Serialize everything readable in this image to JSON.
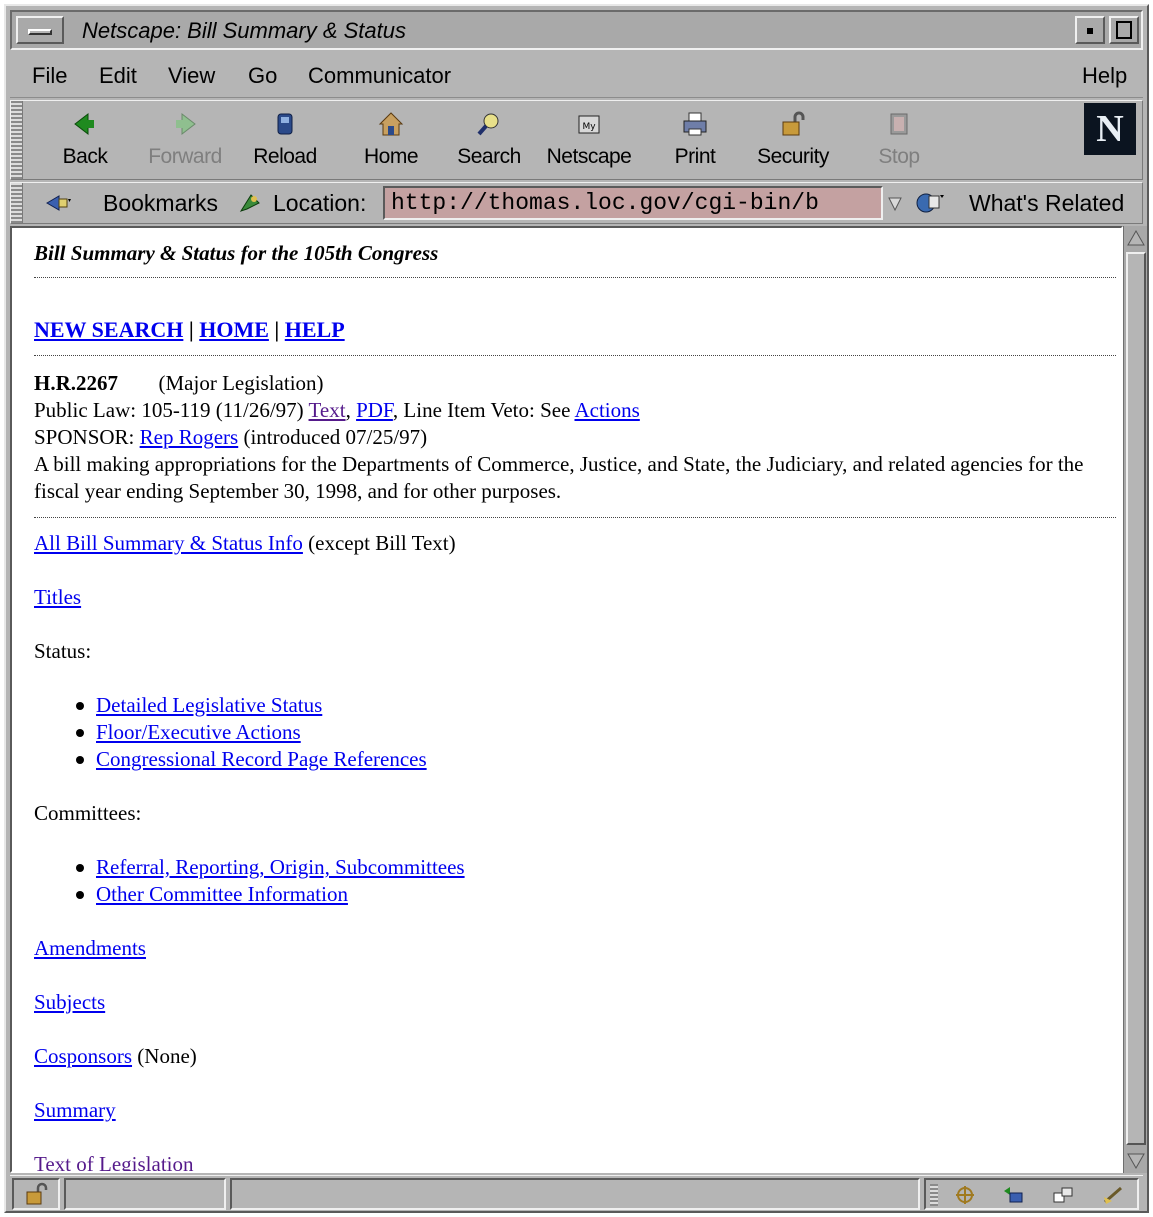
{
  "window": {
    "title": "Netscape: Bill Summary & Status"
  },
  "menu": {
    "file": "File",
    "edit": "Edit",
    "view": "View",
    "go": "Go",
    "communicator": "Communicator",
    "help": "Help"
  },
  "toolbar": {
    "back": "Back",
    "forward": "Forward",
    "reload": "Reload",
    "home": "Home",
    "search": "Search",
    "netscape": "Netscape",
    "print": "Print",
    "security": "Security",
    "stop": "Stop",
    "logo": "N"
  },
  "location": {
    "bookmarks": "Bookmarks",
    "label": "Location:",
    "url": "http://thomas.loc.gov/cgi-bin/b",
    "whats_related": "What's Related"
  },
  "page": {
    "heading": "Bill Summary & Status for the 105th Congress",
    "nav": {
      "new_search": "NEW SEARCH",
      "sep1": " | ",
      "home": "HOME",
      "sep2": " | ",
      "help": "HELP"
    },
    "bill": {
      "number": "H.R.2267",
      "type": "(Major Legislation)",
      "public_law_prefix": "Public Law: 105-119 (11/26/97) ",
      "text_link": "Text",
      "comma": ", ",
      "pdf_link": "PDF",
      "veto_text": ", Line Item Veto: See ",
      "actions_link": "Actions",
      "sponsor_label": "SPONSOR: ",
      "sponsor_link": "Rep Rogers",
      "introduced": " (introduced 07/25/97)",
      "description": "A bill making appropriations for the Departments of Commerce, Justice, and State, the Judiciary, and related agencies for the fiscal year ending September 30, 1998, and for other purposes."
    },
    "links": {
      "all_info": "All Bill Summary & Status Info",
      "all_info_note": " (except Bill Text)",
      "titles": "Titles",
      "status_label": "Status:",
      "status_items": [
        "Detailed Legislative Status",
        "Floor/Executive Actions",
        "Congressional Record Page References"
      ],
      "committees_label": "Committees:",
      "committee_items": [
        "Referral, Reporting, Origin, Subcommittees",
        "Other Committee Information"
      ],
      "amendments": "Amendments",
      "subjects": "Subjects",
      "cosponsors": "Cosponsors",
      "cosponsors_note": " (None)",
      "summary": "Summary",
      "text_of_legislation": "Text of Legislation"
    }
  },
  "colors": {
    "link": "#0000ee",
    "visited": "#551a8b",
    "chrome": "#b5b5b5",
    "url_field": "#c4a1a1"
  }
}
